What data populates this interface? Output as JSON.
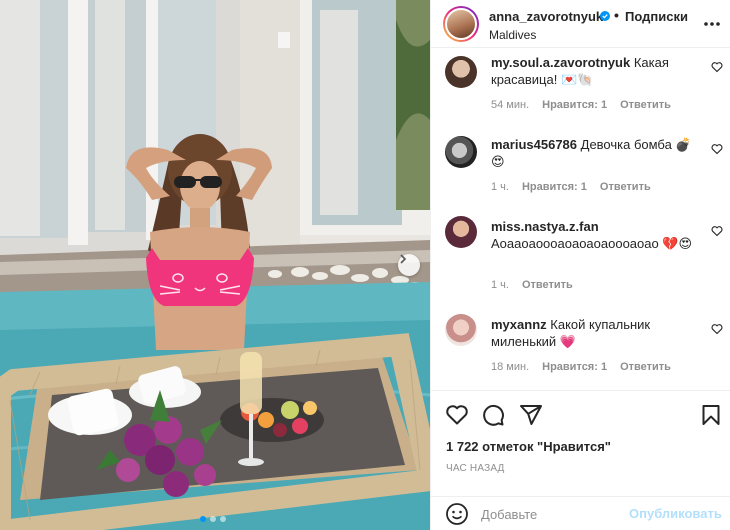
{
  "post": {
    "username": "anna_zavorotnyuk",
    "separator": "•",
    "follow_label": "Подписки",
    "location": "Maldives",
    "likes_text": "1 722 отметок \"Нравится\"",
    "time_ago": "ЧАС НАЗАД"
  },
  "comments": [
    {
      "username": "my.soul.a.zavorotnyuk",
      "text": "Какая красавица! 💌🐚",
      "time": "54 мин.",
      "likes": "Нравится: 1",
      "reply": "Ответить"
    },
    {
      "username": "marius456786",
      "text": "Девочка бомба 💣😍",
      "time": "1 ч.",
      "likes": "Нравится: 1",
      "reply": "Ответить"
    },
    {
      "username": "miss.nastya.z.fan",
      "text": "Аоааоаоооаоаоаоаоооаоао 💔😍",
      "time": "1 ч.",
      "likes": "",
      "reply": "Ответить"
    },
    {
      "username": "myxannz",
      "text": "Какой купальник миленький 💗",
      "time": "18 мин.",
      "likes": "Нравится: 1",
      "reply": "Ответить"
    }
  ],
  "add_comment": {
    "placeholder": "Добавьте",
    "publish_label": "Опубликовать"
  },
  "icons": {
    "more": "more-horizontal-icon",
    "like": "heart-icon",
    "comment": "comment-icon",
    "share": "paper-plane-icon",
    "save": "bookmark-icon",
    "emoji": "smiley-icon",
    "verified": "verified-badge-icon",
    "next": "chevron-right-icon"
  },
  "colors": {
    "accent": "#0095f6",
    "publish_disabled": "#b2dffc",
    "muted_text": "#8e8e8e"
  },
  "carousel": {
    "slides": 3,
    "active": 1
  }
}
